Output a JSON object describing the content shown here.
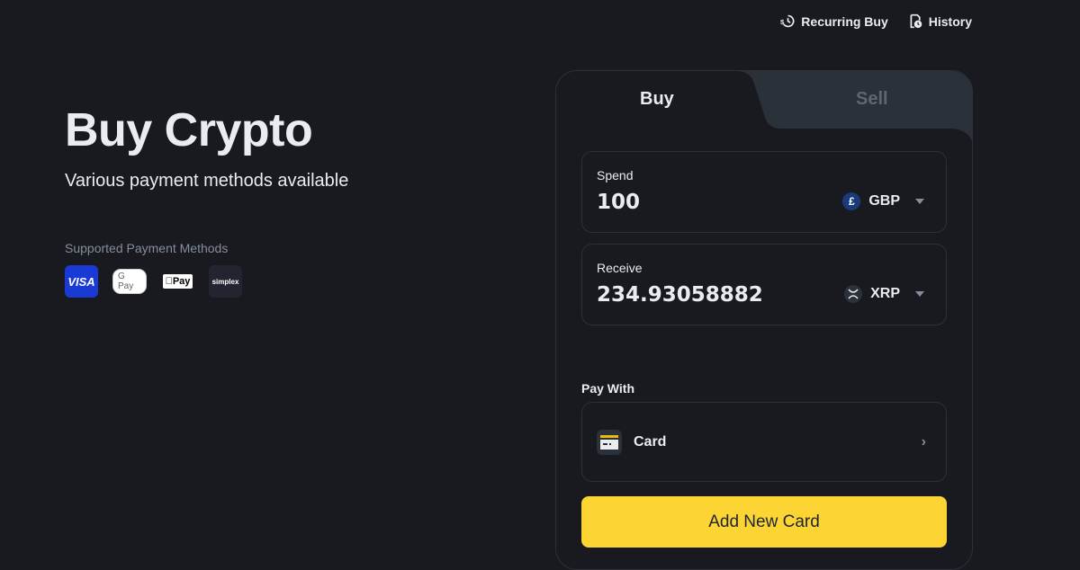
{
  "top_links": {
    "recurring_buy": "Recurring Buy",
    "history": "History"
  },
  "hero": {
    "title": "Buy Crypto",
    "subtitle": "Various payment methods available"
  },
  "payment_methods": {
    "label": "Supported Payment Methods",
    "items": [
      {
        "name": "visa",
        "label": "VISA"
      },
      {
        "name": "google-pay",
        "label": "G Pay"
      },
      {
        "name": "apple-pay",
        "label": "Pay"
      },
      {
        "name": "simplex",
        "label": "simplex"
      }
    ]
  },
  "tabs": {
    "buy": "Buy",
    "sell": "Sell",
    "active": "buy"
  },
  "spend": {
    "label": "Spend",
    "value": "100",
    "currency": "GBP",
    "currency_icon": "£"
  },
  "receive": {
    "label": "Receive",
    "value": "234.93058882",
    "currency": "XRP",
    "currency_icon": "x-icon"
  },
  "pay_with": {
    "label": "Pay With",
    "method": "Card"
  },
  "add_button": "Add New Card",
  "colors": {
    "background": "#181a20",
    "accent": "#fcd535",
    "inactive_tab": "#2b3139",
    "gbp_icon": "#1b3a7a"
  }
}
